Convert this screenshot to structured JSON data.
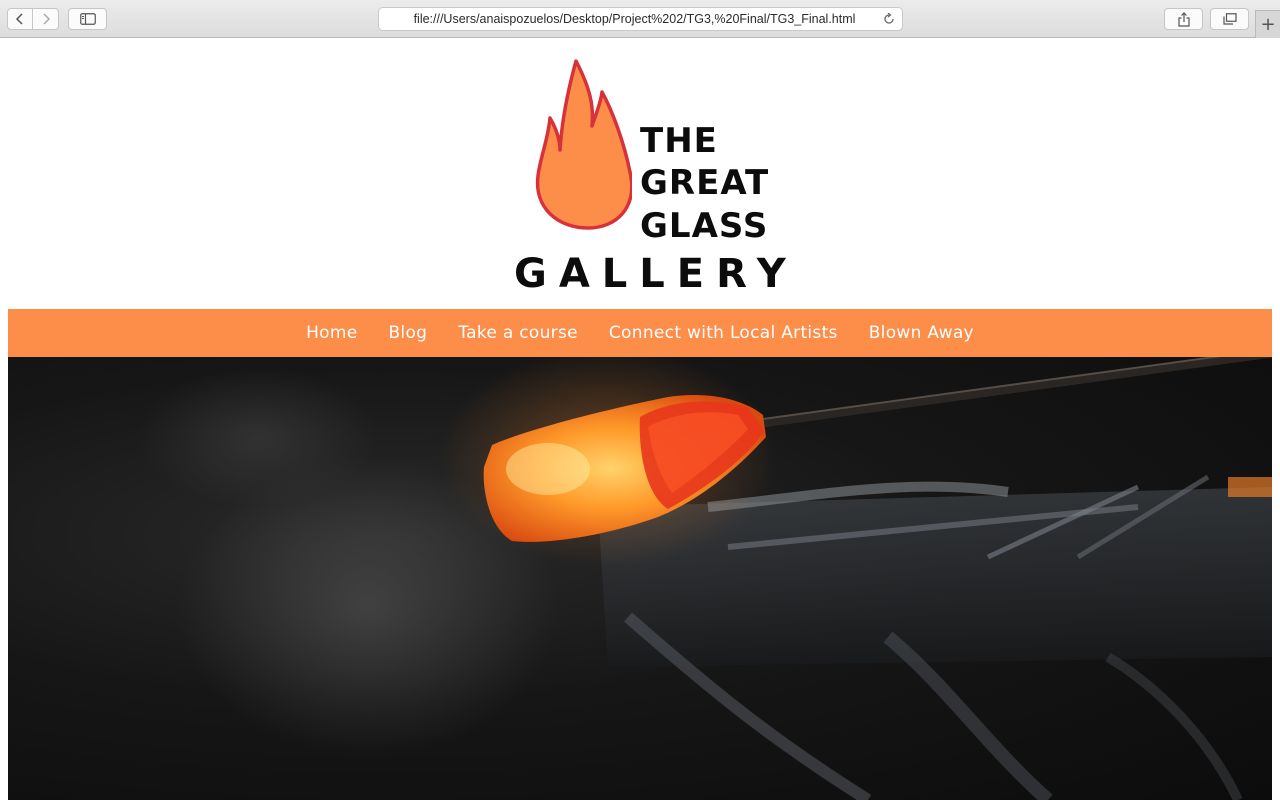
{
  "browser": {
    "url": "file:///Users/anaispozuelos/Desktop/Project%202/TG3,%20Final/TG3_Final.html",
    "new_tab_symbol": "+",
    "icons": {
      "back": "chevron-left-icon",
      "forward": "chevron-right-icon",
      "sidebar": "sidebar-icon",
      "reload": "reload-icon",
      "share": "share-icon",
      "tabs": "tabs-overview-icon"
    }
  },
  "logo": {
    "line1": "THE",
    "line2": "GREAT",
    "line3": "GLASS",
    "line4": "GALLERY",
    "flame_fill": "#fc8e49",
    "flame_stroke": "#d9313a"
  },
  "nav": {
    "items": [
      {
        "label": "Home"
      },
      {
        "label": "Blog"
      },
      {
        "label": "Take a course"
      },
      {
        "label": "Connect with Local Artists"
      },
      {
        "label": "Blown Away"
      }
    ],
    "background": "#fc8e49"
  }
}
